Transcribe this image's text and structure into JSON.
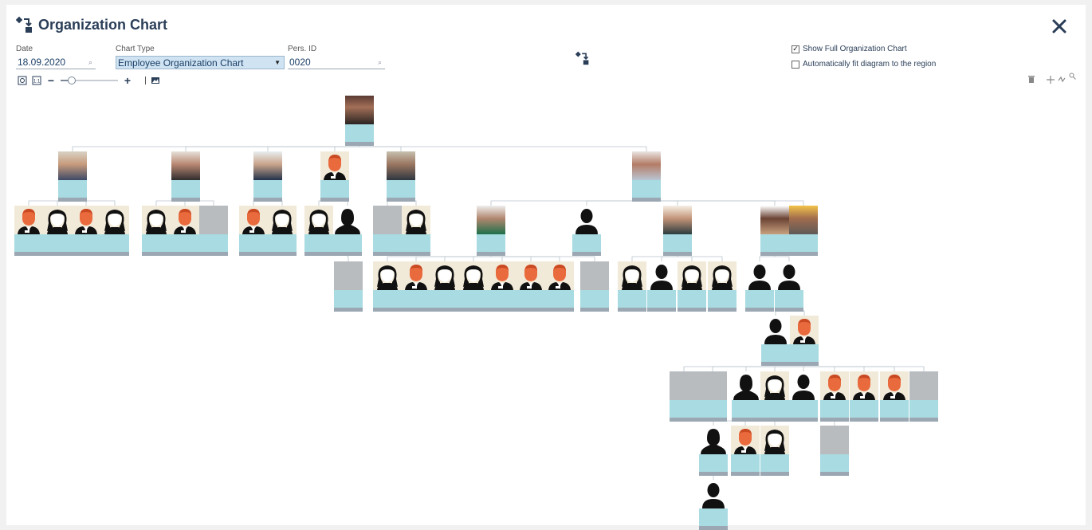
{
  "header": {
    "title": "Organization Chart",
    "close_icon": "close-icon",
    "app_icon": "org-chart-icon"
  },
  "filters": {
    "date": {
      "label": "Date",
      "value": "18.09.2020"
    },
    "chart_type": {
      "label": "Chart Type",
      "value": "Employee Organization Chart"
    },
    "pers_id": {
      "label": "Pers. ID",
      "value": "0020"
    }
  },
  "options": {
    "show_full": {
      "label": "Show Full Organization Chart",
      "checked": true
    },
    "auto_fit": {
      "label": "Automatically fit diagram to the region",
      "checked": false
    }
  },
  "toolbar": {
    "zoom_level": 0.2,
    "icons": [
      "fit-page-icon",
      "actual-size-icon",
      "zoom-out-icon",
      "zoom-slider",
      "zoom-in-icon",
      "export-image-icon"
    ]
  },
  "right_tools": [
    "delete-icon",
    "move-icon",
    "layout-icon",
    "search-icon"
  ],
  "accent": "#a8dbe2",
  "employees": [
    {
      "id": "ceo",
      "photo": "real-a"
    },
    {
      "id": "m1",
      "photo": "real-b",
      "parent": "ceo"
    },
    {
      "id": "m2",
      "photo": "real-c",
      "parent": "ceo"
    },
    {
      "id": "m3",
      "photo": "real-d",
      "parent": "ceo"
    },
    {
      "id": "m4",
      "photo": "avatar-m",
      "parent": "ceo"
    },
    {
      "id": "m5",
      "photo": "real-f",
      "parent": "ceo"
    },
    {
      "id": "m6",
      "photo": "real-g",
      "parent": "ceo"
    },
    {
      "id": "a1",
      "photo": "avatar-m",
      "parent": "m1"
    },
    {
      "id": "a2",
      "photo": "avatar-f",
      "parent": "m1"
    },
    {
      "id": "a3",
      "photo": "avatar-m",
      "parent": "m1"
    },
    {
      "id": "a4",
      "photo": "avatar-f",
      "parent": "m1"
    },
    {
      "id": "b1",
      "photo": "avatar-f",
      "parent": "m2"
    },
    {
      "id": "b2",
      "photo": "avatar-m",
      "parent": "m2"
    },
    {
      "id": "b3",
      "photo": "gray",
      "parent": "m2"
    },
    {
      "id": "c1",
      "photo": "avatar-m",
      "parent": "m3"
    },
    {
      "id": "c2",
      "photo": "avatar-f",
      "parent": "m3"
    },
    {
      "id": "d1",
      "photo": "avatar-f",
      "parent": "m4"
    },
    {
      "id": "d2",
      "photo": "silhouette-f",
      "parent": "m4"
    },
    {
      "id": "e1",
      "photo": "gray",
      "parent": "m5"
    },
    {
      "id": "e2",
      "photo": "avatar-f",
      "parent": "m5"
    },
    {
      "id": "f1",
      "photo": "real-h",
      "parent": "m6"
    },
    {
      "id": "f2",
      "photo": "silhouette-m",
      "parent": "m6"
    },
    {
      "id": "f3",
      "photo": "real-i",
      "parent": "m6"
    },
    {
      "id": "f4",
      "photo": "real-j",
      "parent": "m6"
    },
    {
      "id": "f5",
      "photo": "real-k",
      "parent": "m6"
    },
    {
      "id": "g1",
      "photo": "gray",
      "parent": "d2"
    },
    {
      "id": "h1",
      "photo": "avatar-f",
      "parent": "f1"
    },
    {
      "id": "h2",
      "photo": "avatar-m",
      "parent": "f1"
    },
    {
      "id": "h3",
      "photo": "avatar-f",
      "parent": "f1"
    },
    {
      "id": "h4",
      "photo": "avatar-f",
      "parent": "f1"
    },
    {
      "id": "h5",
      "photo": "avatar-m",
      "parent": "f1"
    },
    {
      "id": "h6",
      "photo": "avatar-m",
      "parent": "f1"
    },
    {
      "id": "h7",
      "photo": "avatar-m",
      "parent": "f1"
    },
    {
      "id": "h8",
      "photo": "gray",
      "parent": "f1"
    },
    {
      "id": "i1",
      "photo": "avatar-f",
      "parent": "f3"
    },
    {
      "id": "i2",
      "photo": "silhouette-m",
      "parent": "f3"
    },
    {
      "id": "i3",
      "photo": "avatar-f",
      "parent": "f3"
    },
    {
      "id": "i4",
      "photo": "avatar-f",
      "parent": "f3"
    },
    {
      "id": "j1",
      "photo": "silhouette-m",
      "parent": "f4"
    },
    {
      "id": "j2",
      "photo": "silhouette-m",
      "parent": "f4"
    },
    {
      "id": "k1",
      "photo": "silhouette-m",
      "parent": "j2"
    },
    {
      "id": "k2",
      "photo": "avatar-m",
      "parent": "j2"
    },
    {
      "id": "l1",
      "photo": "gray",
      "parent": "k2"
    },
    {
      "id": "l2",
      "photo": "gray",
      "parent": "k2"
    },
    {
      "id": "l3",
      "photo": "silhouette-f",
      "parent": "k2"
    },
    {
      "id": "l4",
      "photo": "avatar-f",
      "parent": "k2"
    },
    {
      "id": "l5",
      "photo": "silhouette-m",
      "parent": "k2"
    },
    {
      "id": "l6",
      "photo": "avatar-m",
      "parent": "k2"
    },
    {
      "id": "l7",
      "photo": "avatar-m",
      "parent": "k2"
    },
    {
      "id": "l8",
      "photo": "avatar-m",
      "parent": "k2"
    },
    {
      "id": "l9",
      "photo": "gray",
      "parent": "k2"
    },
    {
      "id": "n1",
      "photo": "silhouette-f",
      "parent": "l3"
    },
    {
      "id": "n2",
      "photo": "avatar-m",
      "parent": "l3"
    },
    {
      "id": "n3",
      "photo": "avatar-f",
      "parent": "l3"
    },
    {
      "id": "n4",
      "photo": "gray",
      "parent": "l6"
    },
    {
      "id": "o1",
      "photo": "silhouette-m",
      "parent": "n1"
    }
  ]
}
